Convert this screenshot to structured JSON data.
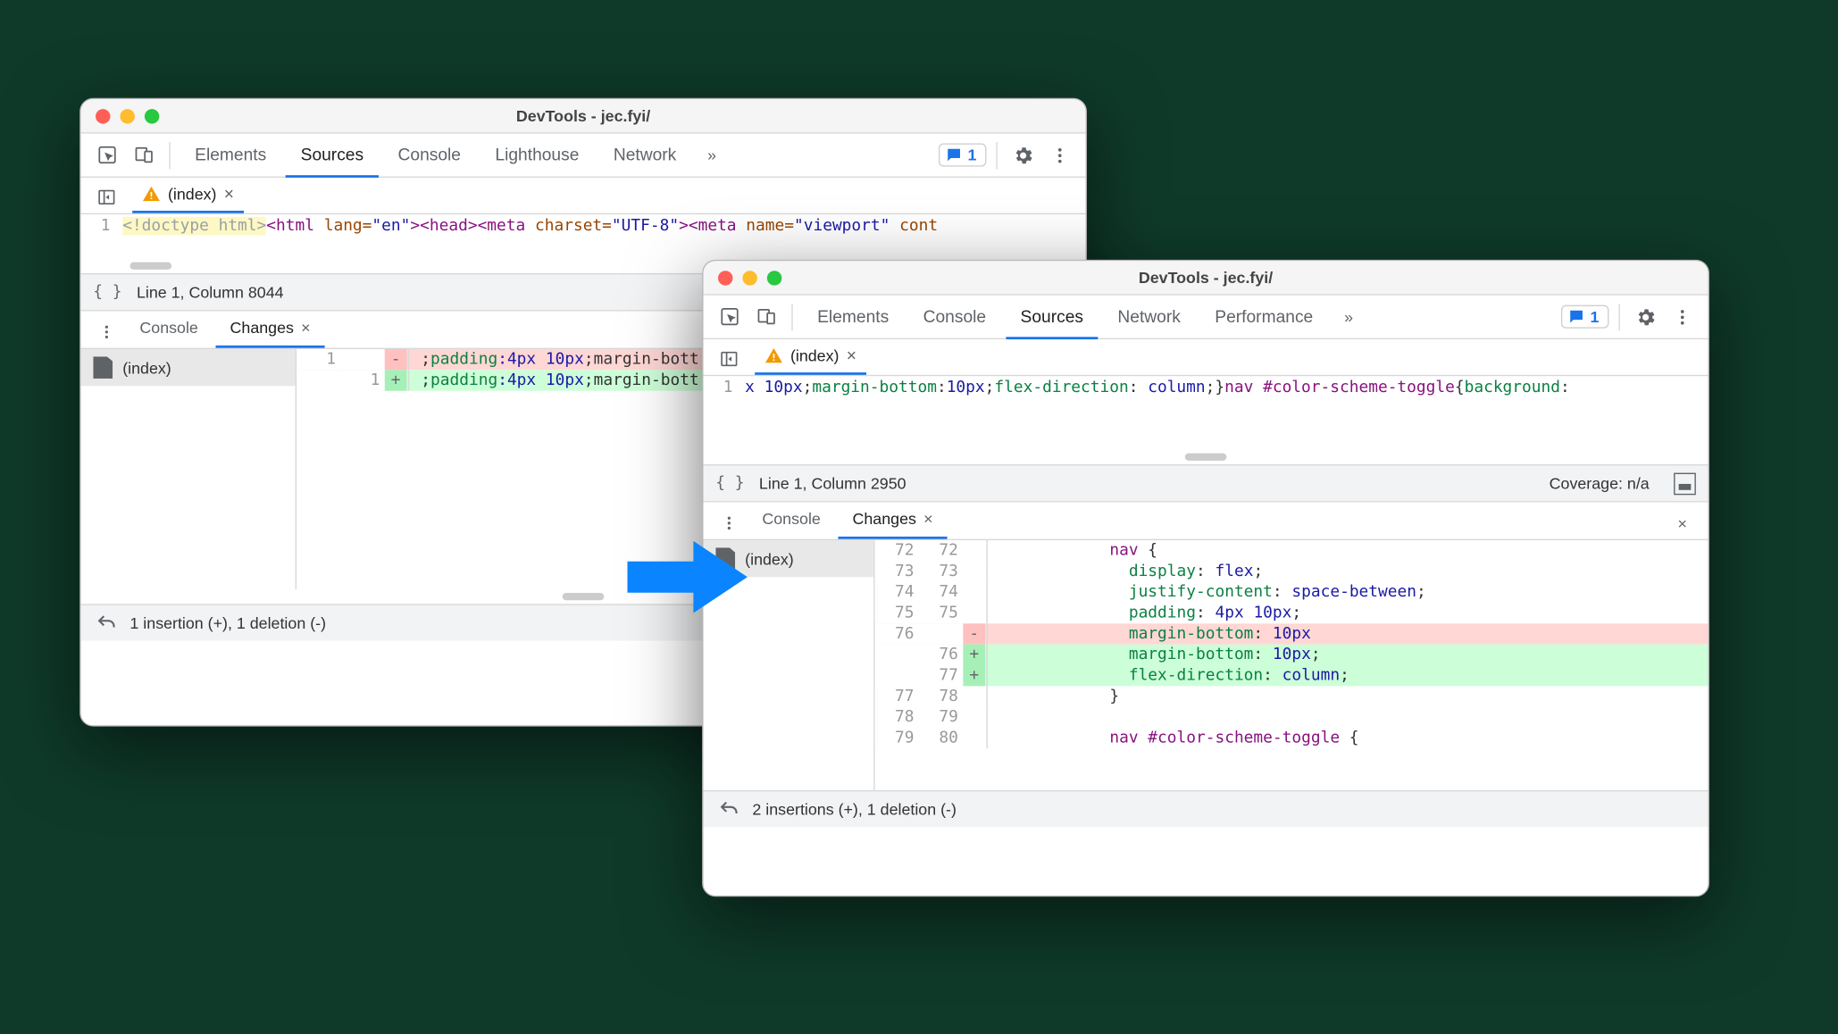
{
  "w1": {
    "title": "DevTools - jec.fyi/",
    "panels": [
      "Elements",
      "Sources",
      "Console",
      "Lighthouse",
      "Network"
    ],
    "active_panel": "Sources",
    "issues_count": "1",
    "file_tab": "(index)",
    "code_line_no": "1",
    "code_tokens": {
      "doctype": "<!doctype html>",
      "html_open": "<html ",
      "lang_attr": "lang=",
      "lang_val": "\"en\"",
      "gt": ">",
      "head": "<head>",
      "meta1": "<meta ",
      "charset_attr": "charset=",
      "charset_val": "\"UTF-8\"",
      "gt2": ">",
      "meta2": "<meta ",
      "name_attr": "name=",
      "name_val": "\"viewport\"",
      "cont": " cont"
    },
    "status_line": "Line 1, Column 8044",
    "drawer": {
      "tabs": [
        "Console",
        "Changes"
      ],
      "active": "Changes",
      "file": "(index)",
      "diff": {
        "old_no": "1",
        "new_no": "1",
        "shared_prefix": ";",
        "prop": "padding",
        "vals": ":4px 10px",
        "suffix": ";margin-bott"
      },
      "summary": "1 insertion (+), 1 deletion (-)"
    }
  },
  "w2": {
    "title": "DevTools - jec.fyi/",
    "panels": [
      "Elements",
      "Console",
      "Sources",
      "Network",
      "Performance"
    ],
    "active_panel": "Sources",
    "issues_count": "1",
    "file_tab": "(index)",
    "code_line_no": "1",
    "code_tokens": {
      "a": "x 10px",
      ";": ";",
      "b": "margin-bottom",
      ":": ":",
      "c": "10px",
      ";2": ";",
      "d": "flex-direction",
      ":2": ": ",
      "e": "column",
      ";3": ";",
      "brace": "}",
      "sel": "nav #color-scheme-toggle",
      "ob": "{",
      "f": "background",
      ":3": ":"
    },
    "status_line": "Line 1, Column 2950",
    "coverage": "Coverage: n/a",
    "drawer": {
      "tabs": [
        "Console",
        "Changes"
      ],
      "active": "Changes",
      "file": "(index)",
      "rows": [
        {
          "o": "72",
          "n": "72",
          "m": "",
          "cls": "",
          "html": "<span class='sel'>nav</span> {"
        },
        {
          "o": "73",
          "n": "73",
          "m": "",
          "cls": "",
          "html": "  <span class='prop'>display</span>: <span class='num'>flex</span>;"
        },
        {
          "o": "74",
          "n": "74",
          "m": "",
          "cls": "",
          "html": "  <span class='prop'>justify-content</span>: <span class='num'>space-between</span>;"
        },
        {
          "o": "75",
          "n": "75",
          "m": "",
          "cls": "",
          "html": "  <span class='prop'>padding</span>: <span class='num'>4px 10px</span>;"
        },
        {
          "o": "76",
          "n": "",
          "m": "-",
          "cls": "del",
          "html": "  <span class='prop'>margin-bottom</span>: <span class='num'>10px</span>"
        },
        {
          "o": "",
          "n": "76",
          "m": "+",
          "cls": "add",
          "html": "  <span class='prop'>margin-bottom</span>: <span class='num'>10px</span>;"
        },
        {
          "o": "",
          "n": "77",
          "m": "+",
          "cls": "add",
          "html": "  <span class='prop'>flex-direction</span>: <span class='num'>column</span>;"
        },
        {
          "o": "77",
          "n": "78",
          "m": "",
          "cls": "",
          "html": "}"
        },
        {
          "o": "78",
          "n": "79",
          "m": "",
          "cls": "",
          "html": ""
        },
        {
          "o": "79",
          "n": "80",
          "m": "",
          "cls": "",
          "html": "<span class='sel'>nav #color-scheme-toggle</span> {"
        }
      ],
      "summary": "2 insertions (+), 1 deletion (-)"
    }
  }
}
